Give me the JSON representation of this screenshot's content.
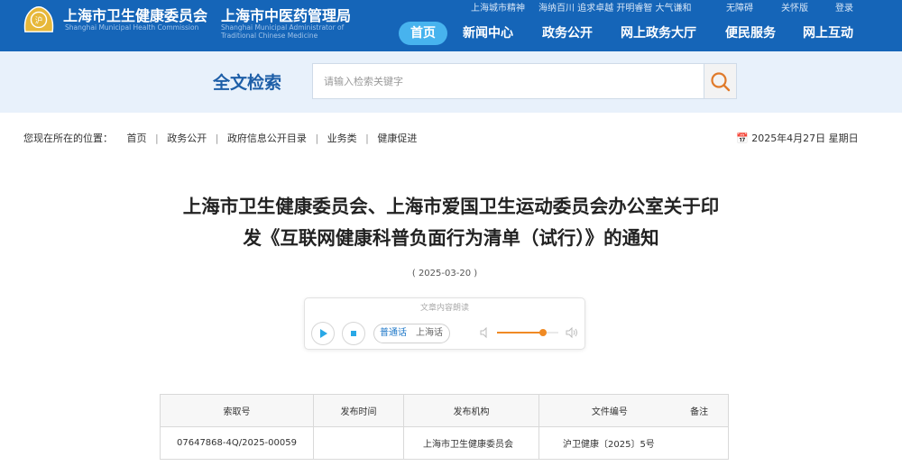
{
  "header": {
    "org_cn_1": "上海市卫生健康委员会",
    "org_cn_2": "上海市中医药管理局",
    "org_en_1": "Shanghai Municipal Health Commission",
    "org_en_2": "Shanghai Municipal Administrator of Traditional Chinese Medicine",
    "top_links": [
      "上海城市精神",
      "海纳百川 追求卓越 开明睿智 大气谦和",
      "无障碍",
      "关怀版",
      "登录"
    ],
    "nav": [
      "首页",
      "新闻中心",
      "政务公开",
      "网上政务大厅",
      "便民服务",
      "网上互动"
    ],
    "active_nav": "首页",
    "brand_color": "#1565b8"
  },
  "search": {
    "title": "全文检索",
    "placeholder": "请输入检索关键字",
    "button_icon": "search-icon"
  },
  "breadcrumb": {
    "label": "您现在所在的位置：",
    "items": [
      "首页",
      "政务公开",
      "政府信息公开目录",
      "业务类",
      "健康促进"
    ],
    "date": "📅 2025年4月27日 星期日"
  },
  "article": {
    "title_line1": "上海市卫生健康委员会、上海市爱国卫生运动委员会办公室关于印",
    "title_line2": "发《互联网健康科普负面行为清单（试行）》的通知",
    "date": "( 2025-03-20 )"
  },
  "player": {
    "caption": "文章内容朗读",
    "lang_1": "普通话",
    "lang_2": "上海话",
    "volume": 0.75,
    "accent": "#f08a24"
  },
  "info_table": {
    "headers": [
      "索取号",
      "发布时间",
      "发布机构",
      "文件编号",
      "备注"
    ],
    "row": [
      "07647868-4Q/2025-00059",
      "",
      "上海市卫生健康委员会",
      "沪卫健康〔2025〕5号",
      ""
    ]
  }
}
